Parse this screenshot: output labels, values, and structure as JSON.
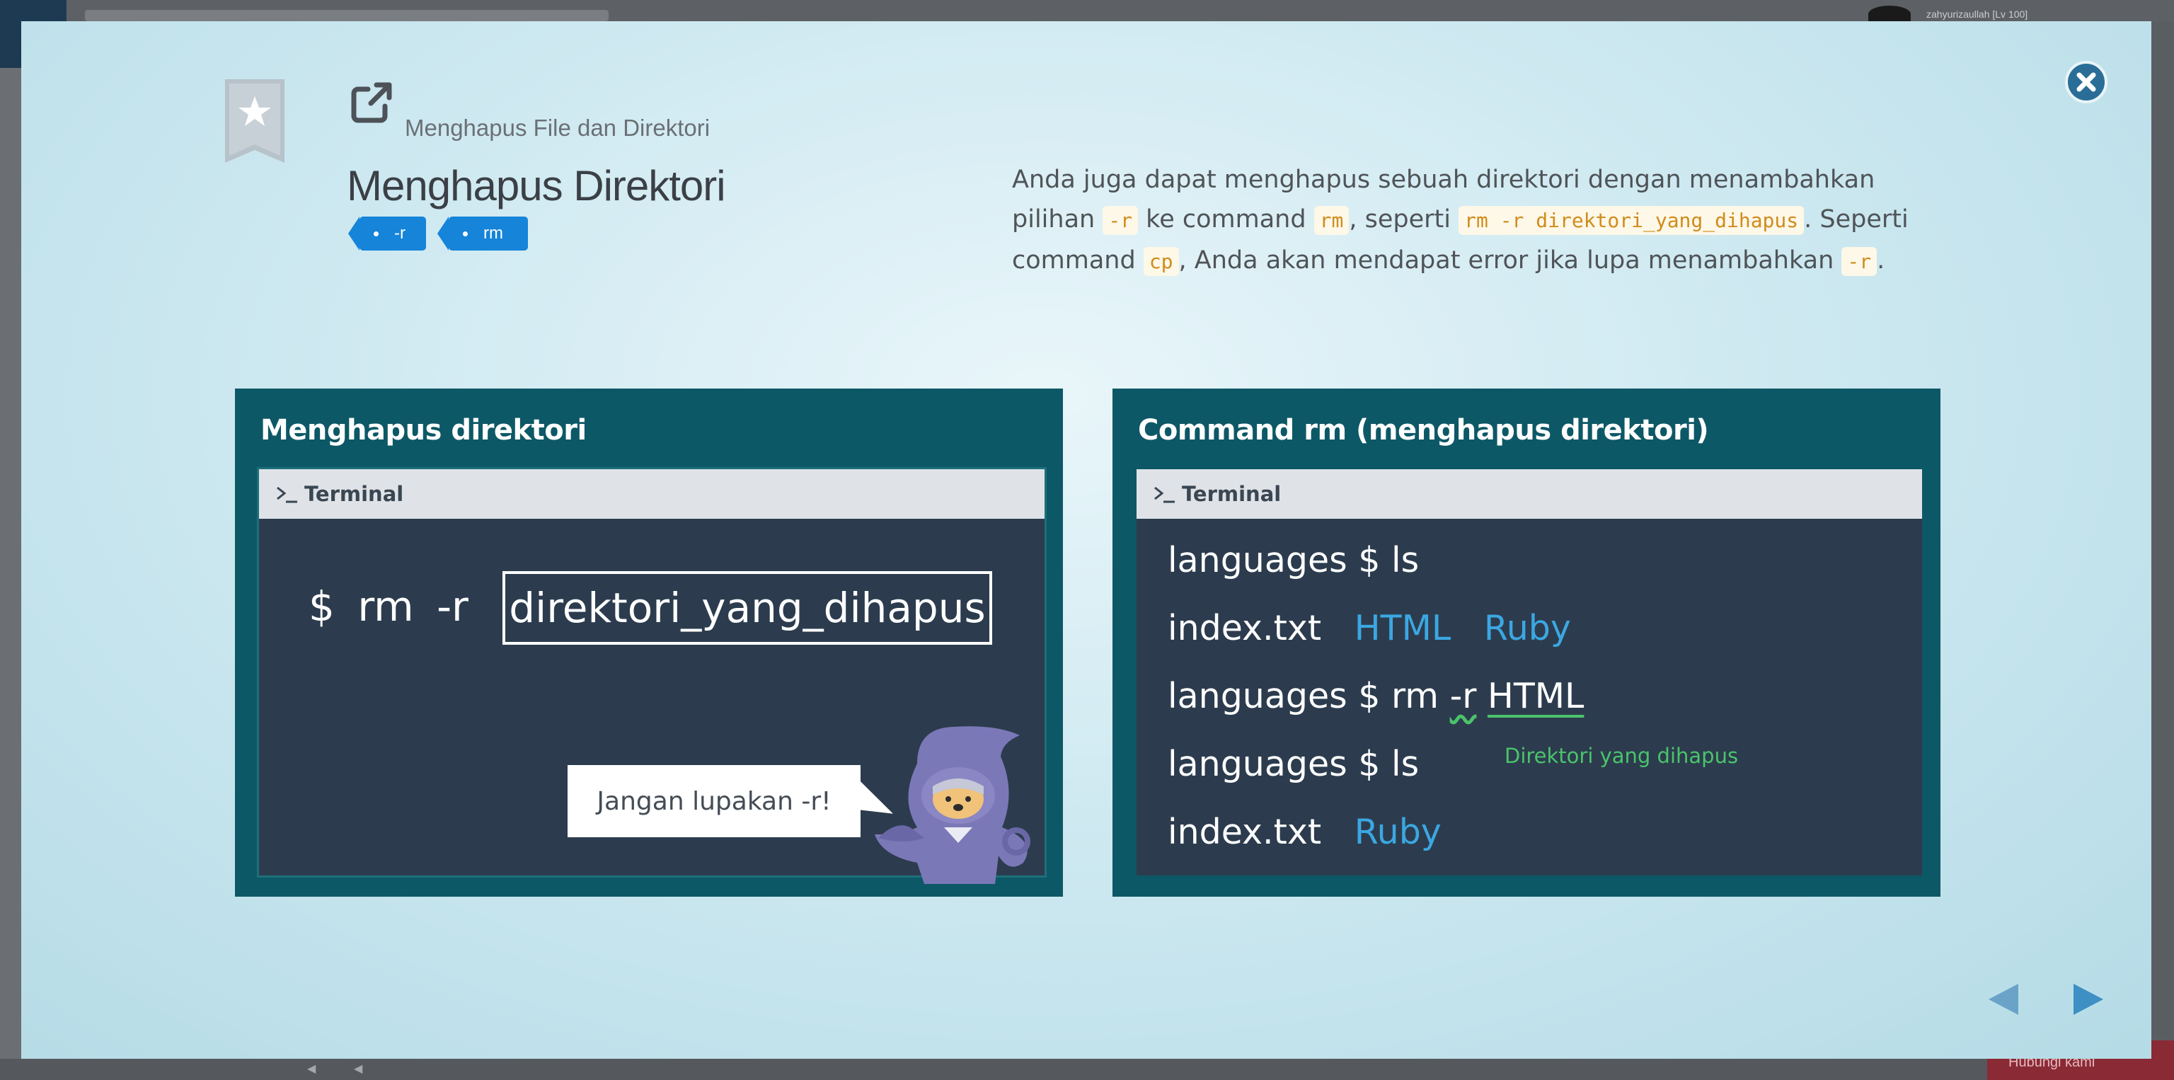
{
  "backdrop": {
    "username": "zahyurizaullah [Lv 100]",
    "red_button": "Hubungi kami"
  },
  "header": {
    "section_title": "Menghapus File dan Direktori",
    "lesson_title": "Menghapus Direktori",
    "tags": [
      "-r",
      "rm"
    ]
  },
  "description": {
    "t1": "Anda juga dapat menghapus sebuah direktori dengan menambahkan pilihan ",
    "c1": "-r",
    "t2": " ke command ",
    "c2": "rm",
    "t3": ", seperti ",
    "c3": "rm -r direktori_yang_dihapus",
    "t4": ". Seperti command ",
    "c4": "cp",
    "t5": ", Anda akan mendapat error jika lupa menambahkan ",
    "c5": "-r",
    "t6": "."
  },
  "slide1": {
    "title": "Menghapus direktori",
    "terminal_label": "Terminal",
    "command": "$ rm -r",
    "boxed_arg": "direktori_yang_dihapus",
    "bubble": "Jangan lupakan -r!"
  },
  "slide2": {
    "title": "Command rm (menghapus direktori)",
    "terminal_label": "Terminal",
    "line1": "languages $ ls",
    "line2_file": "index.txt",
    "line2_dir1": "HTML",
    "line2_dir2": "Ruby",
    "line3_prefix": "languages $ rm ",
    "line3_flag": "-r",
    "line3_arg": "HTML",
    "note": "Direktori yang dihapus",
    "line4": "languages $ ls",
    "line5_file": "index.txt",
    "line5_dir": "Ruby"
  },
  "colors": {
    "accent_blue": "#1584d9",
    "slide_bg": "#0d5866",
    "terminal_bg": "#2c3c4e",
    "code_text": "#d08c1c",
    "dir_blue": "#3ba7e2",
    "note_green": "#4bc36b"
  },
  "icons": {
    "bookmark": "bookmark-star-icon",
    "close": "close-icon",
    "external": "external-link-icon",
    "terminal": "terminal-prompt-icon",
    "prev": "triangle-left-icon",
    "next": "triangle-right-icon"
  }
}
